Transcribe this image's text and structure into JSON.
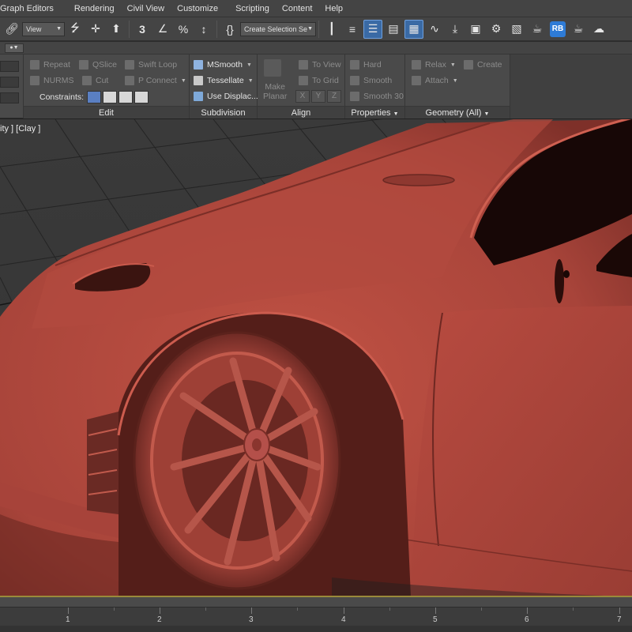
{
  "menu": [
    "Graph Editors",
    "Rendering",
    "Civil View",
    "Customize",
    "Scripting",
    "Content",
    "Help"
  ],
  "toolbar": {
    "view_dropdown": "View",
    "selection_set": "Create Selection Se",
    "rb_badge": "RB"
  },
  "ribbon": {
    "edit": {
      "title": "Edit",
      "repeat": "Repeat",
      "qslice": "QSlice",
      "swift_loop": "Swift Loop",
      "nurms": "NURMS",
      "cut": "Cut",
      "p_connect": "P Connect",
      "constraints": "Constraints:"
    },
    "subdivision": {
      "title": "Subdivision",
      "msmooth": "MSmooth",
      "tessellate": "Tessellate",
      "use_displace": "Use Displac..."
    },
    "align": {
      "title": "Align",
      "make_planar_1": "Make",
      "make_planar_2": "Planar",
      "to_view": "To View",
      "to_grid": "To Grid",
      "x": "X",
      "y": "Y",
      "z": "Z"
    },
    "properties": {
      "title": "Properties",
      "hard": "Hard",
      "smooth": "Smooth",
      "smooth30": "Smooth 30"
    },
    "geometry": {
      "title": "Geometry (All)",
      "relax": "Relax",
      "create": "Create",
      "attach": "Attach"
    }
  },
  "viewport": {
    "label": "ity ] [Clay ]"
  },
  "timeline": {
    "ticks": [
      "1",
      "2",
      "3",
      "4",
      "5",
      "6",
      "7"
    ]
  },
  "colors": {
    "car_clay": "#b4473c",
    "active_blue": "#3a6aa5"
  }
}
